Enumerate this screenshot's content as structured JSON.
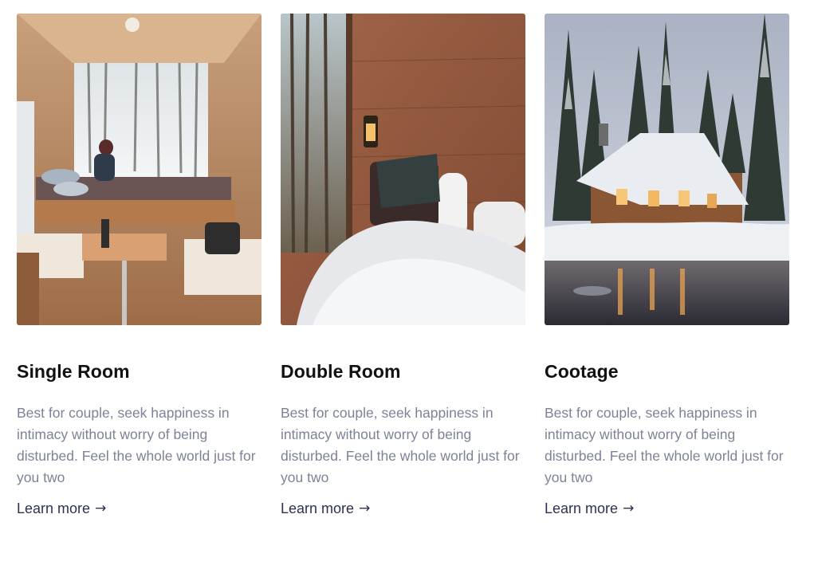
{
  "cards": [
    {
      "title": "Single Room",
      "description": "Best for couple, seek happiness in intimacy without worry of being disturbed. Feel the whole world just for you two",
      "link_label": "Learn more",
      "arrow": "→",
      "image": "cabin-interior-bed-snow-window"
    },
    {
      "title": "Double Room",
      "description": "Best for couple, seek happiness in intimacy without worry of being disturbed. Feel the whole world just for you two",
      "link_label": "Learn more",
      "arrow": "→",
      "image": "reading-in-bed-wood-wall"
    },
    {
      "title": "Cootage",
      "description": "Best for couple, seek happiness in intimacy without worry of being disturbed. Feel the whole world just for you two",
      "link_label": "Learn more",
      "arrow": "→",
      "image": "snowy-cabin-by-lake"
    }
  ],
  "colors": {
    "title": "#111111",
    "description": "#7d8397",
    "link": "#2d3250"
  }
}
